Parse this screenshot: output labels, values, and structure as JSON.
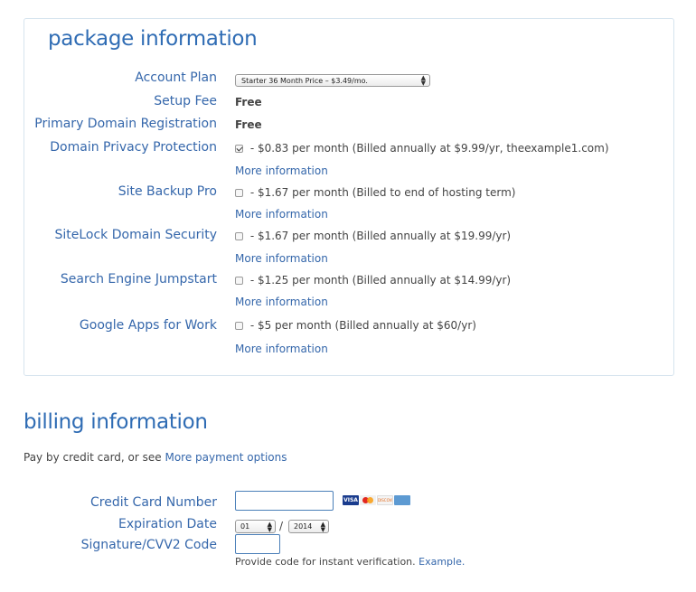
{
  "package": {
    "title": "package information",
    "account_plan": {
      "label": "Account Plan",
      "selected": "Starter 36 Month Price – $3.49/mo."
    },
    "setup_fee": {
      "label": "Setup Fee",
      "value": "Free"
    },
    "primary_domain": {
      "label": "Primary Domain Registration",
      "value": "Free"
    },
    "addons": [
      {
        "label": "Domain Privacy Protection",
        "checked": true,
        "text": " - $0.83 per month (Billed annually at $9.99/yr, theexample1.com)",
        "more": "More information"
      },
      {
        "label": "Site Backup Pro",
        "checked": false,
        "text": " - $1.67 per month (Billed to end of hosting term)",
        "more": "More information"
      },
      {
        "label": "SiteLock Domain Security",
        "checked": false,
        "text": " - $1.67 per month (Billed annually at $19.99/yr)",
        "more": "More information"
      },
      {
        "label": "Search Engine Jumpstart",
        "checked": false,
        "text": " - $1.25 per month (Billed annually at $14.99/yr)",
        "more": "More information"
      },
      {
        "label": "Google Apps for Work",
        "checked": false,
        "text": " - $5 per month (Billed annually at $60/yr)",
        "more": "More information"
      }
    ]
  },
  "billing": {
    "title": "billing information",
    "pay_intro": "Pay by credit card, or see ",
    "more_payment_link": "More payment options",
    "credit_card": {
      "label": "Credit Card Number",
      "value": ""
    },
    "card_icons": [
      "visa-icon",
      "mastercard-icon",
      "discover-icon",
      "amex-icon"
    ],
    "card_icon_text": {
      "visa": "VISA",
      "discover": "DISCOVER"
    },
    "expiration": {
      "label": "Expiration Date",
      "month": "01",
      "separator": "/",
      "year": "2014"
    },
    "cvv": {
      "label": "Signature/CVV2 Code",
      "value": "",
      "help": "Provide code for instant verification. ",
      "example_link": "Example."
    }
  },
  "colors": {
    "accent": "#3567ab",
    "title": "#2f6cb4",
    "border": "#d6e4ee"
  }
}
